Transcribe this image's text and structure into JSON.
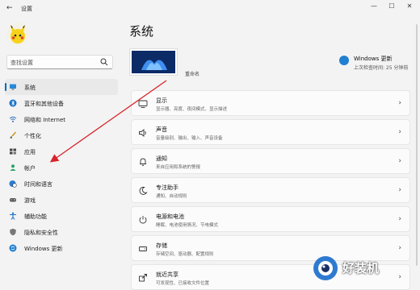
{
  "window": {
    "title": "设置",
    "back_glyph": "←",
    "minimize": "—",
    "maximize": "☐",
    "close": "✕"
  },
  "search": {
    "placeholder": "查找设置"
  },
  "sidebar": {
    "items": [
      {
        "label": "系统",
        "icon": "monitor-icon",
        "active": true
      },
      {
        "label": "蓝牙和其他设备",
        "icon": "bluetooth-icon"
      },
      {
        "label": "网络和 Internet",
        "icon": "network-icon"
      },
      {
        "label": "个性化",
        "icon": "brush-icon"
      },
      {
        "label": "应用",
        "icon": "apps-icon"
      },
      {
        "label": "帐户",
        "icon": "account-icon"
      },
      {
        "label": "时间和语言",
        "icon": "globe-clock-icon"
      },
      {
        "label": "游戏",
        "icon": "gamepad-icon"
      },
      {
        "label": "辅助功能",
        "icon": "accessibility-icon"
      },
      {
        "label": "隐私和安全性",
        "icon": "shield-icon"
      },
      {
        "label": "Windows 更新",
        "icon": "update-icon"
      }
    ]
  },
  "main": {
    "title": "系统",
    "rename": "重命名",
    "update": {
      "title": "Windows 更新",
      "subtitle": "上次检查时间: 25 分钟前"
    },
    "cards": [
      {
        "title": "显示",
        "subtitle": "显示器、亮度、夜间模式、显示描述",
        "icon": "display-icon"
      },
      {
        "title": "声音",
        "subtitle": "音量级别、输出、输入、声音设备",
        "icon": "speaker-icon"
      },
      {
        "title": "通知",
        "subtitle": "来自应用和系统的警报",
        "icon": "bell-icon"
      },
      {
        "title": "专注助手",
        "subtitle": "通知、自动规则",
        "icon": "moon-icon"
      },
      {
        "title": "电源和电池",
        "subtitle": "睡眠、电池使用情况、节电模式",
        "icon": "power-icon"
      },
      {
        "title": "存储",
        "subtitle": "存储空间、驱动器、配置规则",
        "icon": "storage-icon"
      },
      {
        "title": "就近共享",
        "subtitle": "可发现性、已接收文件位置",
        "icon": "share-icon"
      }
    ],
    "chevron": "›"
  },
  "watermark": {
    "text": "好装机"
  },
  "colors": {
    "accent": "#0067c0",
    "annotation_arrow": "#d8232a",
    "background": "#f3f3f3"
  }
}
